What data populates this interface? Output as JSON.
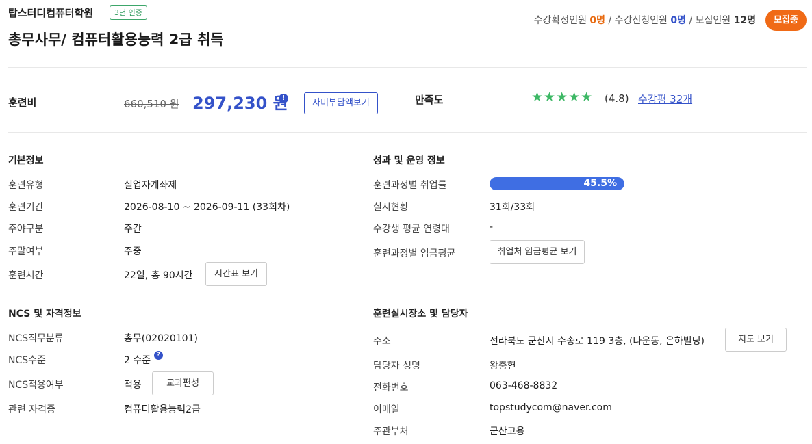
{
  "header": {
    "institution": "탑스터디컴퓨터학원",
    "cert_badge": "3년 인증",
    "course_title": "총무사무/ 컴퓨터활용능력 2급 취득",
    "confirmed_label": "수강확정인원",
    "confirmed_value": "0명",
    "applied_label": "수강신청인원",
    "applied_value": "0명",
    "capacity_label": "모집인원",
    "capacity_value": "12명",
    "separator": "/",
    "status": "모집중"
  },
  "fee": {
    "label": "훈련비",
    "original": "660,510 원",
    "price": "297,230 원",
    "info_icon": "!",
    "self_pay_button": "자비부담액보기"
  },
  "satisfaction": {
    "label": "만족도",
    "stars": "★★★★★",
    "score": "(4.8)",
    "reviews_link": "수강평 32개"
  },
  "basic": {
    "title": "기본정보",
    "rows": [
      {
        "key": "훈련유형",
        "value": "실업자계좌제"
      },
      {
        "key": "훈련기간",
        "value": "2026-08-10 ~ 2026-09-11 (33회차)"
      },
      {
        "key": "주야구분",
        "value": "주간"
      },
      {
        "key": "주말여부",
        "value": "주중"
      },
      {
        "key": "훈련시간",
        "value": "22일, 총 90시간"
      }
    ],
    "timetable_button": "시간표 보기"
  },
  "performance": {
    "title": "성과 및 운영 정보",
    "employment_label": "훈련과정별 취업률",
    "employment_rate": "45.5%",
    "employment_fraction": 0.455,
    "progress_label": "실시현황",
    "progress_value": "31회/33회",
    "avg_age_label": "수강생 평균 연령대",
    "avg_age_value": "-",
    "wage_label": "훈련과정별 임금평균",
    "wage_button": "취업처 임금평균 보기"
  },
  "ncs": {
    "title": "NCS 및 자격정보",
    "job_class_label": "NCS직무분류",
    "job_class_value": "총무(02020101)",
    "level_label": "NCS수준",
    "level_value": "2 수준",
    "level_help": "?",
    "applied_label": "NCS적용여부",
    "applied_value": "적용",
    "curriculum_button": "교과편성",
    "cert_label": "관련 자격증",
    "cert_value": "컴퓨터활용능력2급"
  },
  "location": {
    "title": "훈련실시장소 및 담당자",
    "address_label": "주소",
    "address_value": "전라북도 군산시 수송로 119 3층, (나운동, 은하빌딩)",
    "map_button": "지도 보기",
    "manager_label": "담당자 성명",
    "manager_value": "왕충헌",
    "phone_label": "전화번호",
    "phone_value": "063-468-8832",
    "email_label": "이메일",
    "email_value": "topstudycom@naver.com",
    "dept_label": "주관부처",
    "dept_value": "군산고용"
  },
  "colors": {
    "accent_blue": "#3452c9",
    "status_orange": "#f06a16",
    "star_green": "#3db865",
    "bar_blue": "#3f6ee3"
  }
}
